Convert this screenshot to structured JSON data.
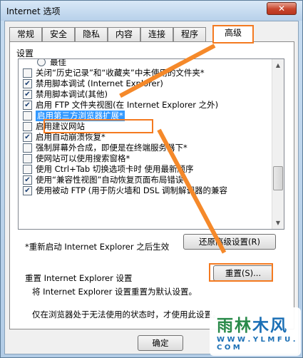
{
  "window": {
    "title": "Internet 选项",
    "close_glyph": "✕"
  },
  "tabs": [
    {
      "label": "常规"
    },
    {
      "label": "安全"
    },
    {
      "label": "隐私"
    },
    {
      "label": "内容"
    },
    {
      "label": "连接"
    },
    {
      "label": "程序"
    },
    {
      "label": "高级",
      "active": true
    }
  ],
  "settings_label": "设置",
  "settings": [
    {
      "label": "最佳",
      "type": "radio",
      "checked": false
    },
    {
      "label": "关闭“历史记录”和“收藏夹”中未使用的文件夹*",
      "type": "checkbox",
      "checked": false
    },
    {
      "label": "禁用脚本调试 (Internet Explorer)",
      "type": "checkbox",
      "checked": true
    },
    {
      "label": "禁用脚本调试(其他)",
      "type": "checkbox",
      "checked": true
    },
    {
      "label": "启用 FTP 文件夹视图(在 Internet Explorer 之外)",
      "type": "checkbox",
      "checked": true
    },
    {
      "label": "启用第三方浏览器扩展*",
      "type": "checkbox",
      "checked": false,
      "highlight": true
    },
    {
      "label": "启用建议网站",
      "type": "checkbox",
      "checked": false
    },
    {
      "label": "启用自动崩溃恢复*",
      "type": "checkbox",
      "checked": true
    },
    {
      "label": "强制屏幕外合成，即便是在终端服务器下*",
      "type": "checkbox",
      "checked": false
    },
    {
      "label": "使网站可以使用搜索窗格*",
      "type": "checkbox",
      "checked": false
    },
    {
      "label": "使用 Ctrl+Tab 切换选项卡时  使用最新顺序",
      "type": "checkbox",
      "checked": false
    },
    {
      "label": "使用“兼容性视图”自动恢复页面布局错误",
      "type": "checkbox",
      "checked": true
    },
    {
      "label": "使用被动 FTP (用于防火墙和 DSL 调制解调器的兼容",
      "type": "checkbox",
      "checked": true
    }
  ],
  "scroll_up_glyph": "▲",
  "scroll_down_glyph": "▼",
  "restart_note": "*重新启动 Internet Explorer 之后生效",
  "restore_button": "还原高级设置(R)",
  "reset_section": {
    "label": "重置 Internet Explorer 设置",
    "desc": "将 Internet Explorer 设置重置为默认设置。",
    "button": "重置(S)...",
    "tip": "仅在浏览器处于无法使用的状态时，才使用此设置。"
  },
  "ok_button": "确定",
  "watermark": {
    "title_a": "雨林",
    "title_b": "木风",
    "url": "W W W . Y L M F U . C O M"
  },
  "colors": {
    "annotation": "#f47a20",
    "selection": "#3399ff",
    "checkmark": "#1a3f73"
  }
}
